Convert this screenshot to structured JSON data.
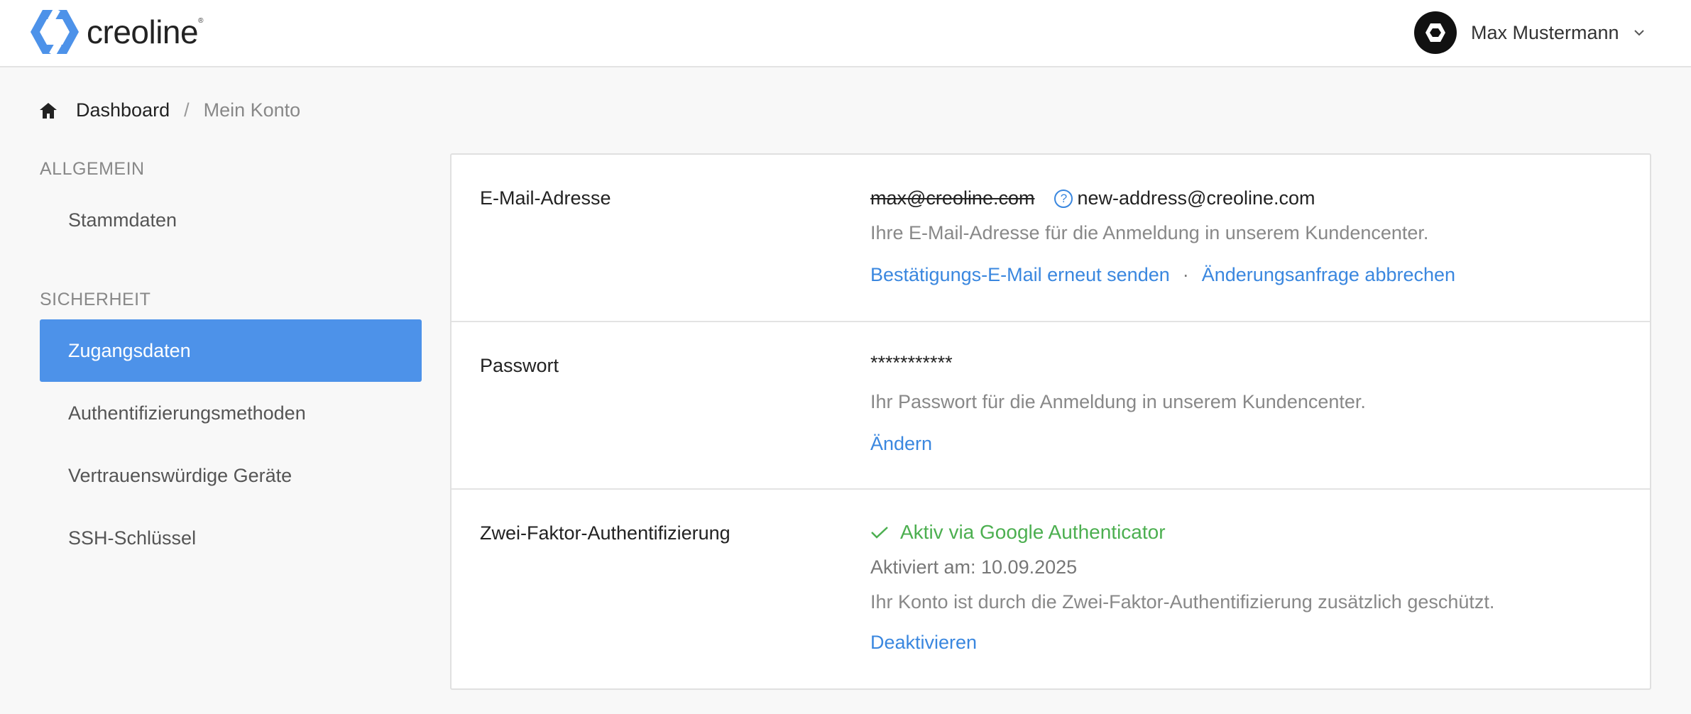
{
  "brand": {
    "name": "creoline",
    "mark": "®",
    "color": "#4d92e9"
  },
  "user": {
    "name": "Max Mustermann"
  },
  "breadcrumb": {
    "home": "Dashboard",
    "separator": "/",
    "current": "Mein Konto"
  },
  "sidebar": {
    "general_heading": "ALLGEMEIN",
    "general_items": [
      {
        "label": "Stammdaten"
      }
    ],
    "security_heading": "SICHERHEIT",
    "security_items": [
      {
        "label": "Zugangsdaten",
        "active": true
      },
      {
        "label": "Authentifizierungsmethoden"
      },
      {
        "label": "Vertrauenswürdige Geräte"
      },
      {
        "label": "SSH-Schlüssel"
      }
    ]
  },
  "email": {
    "label": "E-Mail-Adresse",
    "old_value": "max@creoline.com",
    "new_value": "new-address@creoline.com",
    "description": "Ihre E-Mail-Adresse für die Anmeldung in unserem Kundencenter.",
    "resend_link": "Bestätigungs-E-Mail erneut senden",
    "separator": "·",
    "cancel_link": "Änderungsanfrage abbrechen"
  },
  "password": {
    "label": "Passwort",
    "value": "***********",
    "description": "Ihr Passwort für die Anmeldung in unserem Kundencenter.",
    "change_link": "Ändern"
  },
  "twofa": {
    "label": "Zwei-Faktor-Authentifizierung",
    "status": "Aktiv via Google Authenticator",
    "activated": "Aktiviert am: 10.09.2025",
    "description": "Ihr Konto ist durch die Zwei-Faktor-Authentifizierung zusätzlich geschützt.",
    "deactivate_link": "Deaktivieren"
  },
  "colors": {
    "accent": "#4d92e9",
    "link": "#3a87df",
    "success": "#4caf50"
  }
}
